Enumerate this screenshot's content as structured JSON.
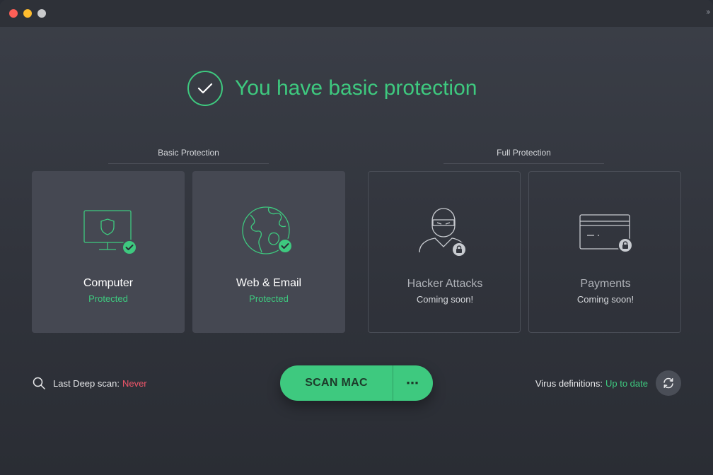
{
  "window": {
    "controls": [
      "close",
      "minimize",
      "zoom"
    ],
    "expand_icon": "double-chevron-right-icon"
  },
  "status": {
    "title": "You have basic protection",
    "icon": "check-circle-icon",
    "color": "#3ec97f"
  },
  "sections": {
    "basic_label": "Basic Protection",
    "full_label": "Full Protection"
  },
  "cards": [
    {
      "title": "Computer",
      "status": "Protected",
      "icon": "monitor-shield-icon",
      "badge": "check-badge-icon",
      "state": "active"
    },
    {
      "title": "Web & Email",
      "status": "Protected",
      "icon": "globe-icon",
      "badge": "check-badge-icon",
      "state": "active"
    },
    {
      "title": "Hacker Attacks",
      "status": "Coming soon!",
      "icon": "hacker-icon",
      "badge": "lock-badge-icon",
      "state": "locked"
    },
    {
      "title": "Payments",
      "status": "Coming soon!",
      "icon": "credit-card-icon",
      "badge": "lock-badge-icon",
      "state": "locked"
    }
  ],
  "footer": {
    "scan_label": "Last Deep scan:",
    "scan_value": "Never",
    "scan_value_color": "#f0566a",
    "scan_button": "SCAN MAC",
    "more_button": "⋯",
    "defs_label": "Virus definitions:",
    "defs_value": "Up to date",
    "refresh_icon": "refresh-icon"
  },
  "colors": {
    "accent_green": "#3ec97f",
    "background": "#33363e",
    "warning_red": "#f0566a"
  }
}
